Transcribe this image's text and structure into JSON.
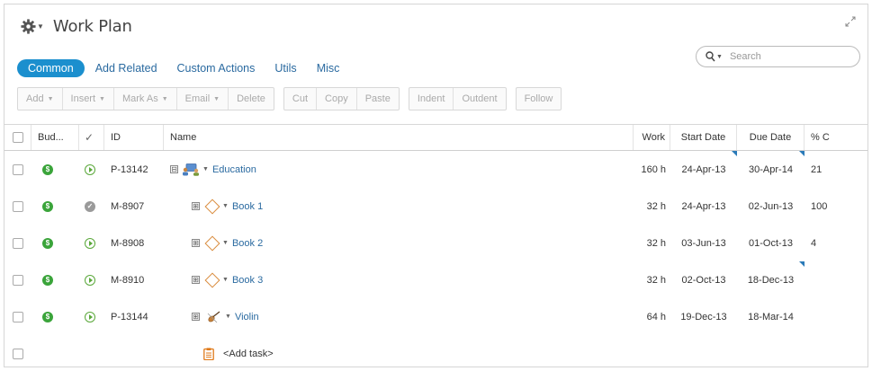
{
  "header": {
    "title": "Work Plan",
    "gear_icon": "gear-icon",
    "expand_icon": "expand-icon"
  },
  "search": {
    "placeholder": "Search"
  },
  "tabs": [
    {
      "label": "Common",
      "active": true
    },
    {
      "label": "Add Related"
    },
    {
      "label": "Custom Actions"
    },
    {
      "label": "Utils"
    },
    {
      "label": "Misc"
    }
  ],
  "toolbar": {
    "g1": {
      "add": "Add",
      "insert": "Insert",
      "mark_as": "Mark As",
      "email": "Email",
      "delete": "Delete"
    },
    "g2": {
      "cut": "Cut",
      "copy": "Copy",
      "paste": "Paste"
    },
    "g3": {
      "indent": "Indent",
      "outdent": "Outdent"
    },
    "g4": {
      "follow": "Follow"
    }
  },
  "columns": {
    "budget": "Bud...",
    "status": "✓",
    "id": "ID",
    "name": "Name",
    "work": "Work",
    "start": "Start Date",
    "due": "Due Date",
    "pct": "% C"
  },
  "rows": [
    {
      "id": "P-13142",
      "name": "Education",
      "work": "160 h",
      "start": "24-Apr-13",
      "due": "30-Apr-14",
      "pct": "21",
      "status": "in-progress",
      "icon": "project-icon",
      "expand": "⊟"
    },
    {
      "id": "M-8907",
      "name": "Book 1",
      "work": "32 h",
      "start": "24-Apr-13",
      "due": "02-Jun-13",
      "pct": "100",
      "status": "completed",
      "icon": "milestone-icon",
      "expand": "⊞"
    },
    {
      "id": "M-8908",
      "name": "Book 2",
      "work": "32 h",
      "start": "03-Jun-13",
      "due": "01-Oct-13",
      "pct": "4",
      "status": "in-progress",
      "icon": "milestone-icon",
      "expand": "⊞"
    },
    {
      "id": "M-8910",
      "name": "Book 3",
      "work": "32 h",
      "start": "02-Oct-13",
      "due": "18-Dec-13",
      "pct": "",
      "status": "in-progress",
      "icon": "milestone-icon",
      "expand": "⊞"
    },
    {
      "id": "P-13144",
      "name": "Violin",
      "work": "64 h",
      "start": "19-Dec-13",
      "due": "18-Mar-14",
      "pct": "",
      "status": "in-progress",
      "icon": "violin-icon",
      "expand": "⊞"
    }
  ],
  "add_task": "<Add task>",
  "colors": {
    "accent": "#1b8fce",
    "link": "#2a6aa0",
    "budget": "#3aa43a",
    "status_ok": "#5aa83a",
    "milestone": "#d98a3a"
  }
}
